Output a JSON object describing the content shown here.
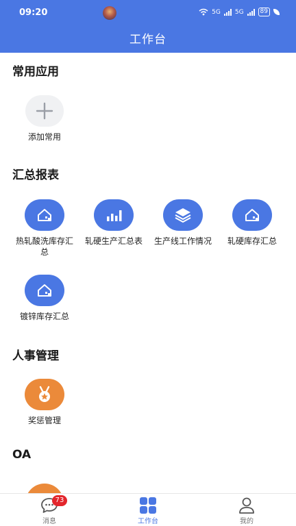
{
  "status_bar": {
    "time": "09:20",
    "net1": "5G",
    "net2": "5G",
    "battery": "89"
  },
  "header": {
    "title": "工作台"
  },
  "sections": {
    "common": {
      "title": "常用应用",
      "add_label": "添加常用",
      "add_icon": "plus-icon"
    },
    "reports": {
      "title": "汇总报表",
      "items": [
        {
          "label": "热轧酸洗库存汇总",
          "icon": "warehouse-icon"
        },
        {
          "label": "轧硬生产汇总表",
          "icon": "bar-chart-icon"
        },
        {
          "label": "生产线工作情况",
          "icon": "layers-icon"
        },
        {
          "label": "轧硬库存汇总",
          "icon": "warehouse-icon"
        },
        {
          "label": "镀锌库存汇总",
          "icon": "warehouse-icon"
        }
      ]
    },
    "hr": {
      "title": "人事管理",
      "items": [
        {
          "label": "奖惩管理",
          "icon": "medal-icon"
        }
      ]
    },
    "oa": {
      "title": "OA"
    }
  },
  "tabbar": {
    "items": [
      {
        "label": "消息",
        "icon": "chat-icon",
        "badge": "73"
      },
      {
        "label": "工作台",
        "icon": "grid-icon"
      },
      {
        "label": "我的",
        "icon": "person-icon"
      }
    ]
  },
  "colors": {
    "primary": "#4a77e3",
    "accent": "#eb8a3a",
    "badge": "#e3262c"
  }
}
